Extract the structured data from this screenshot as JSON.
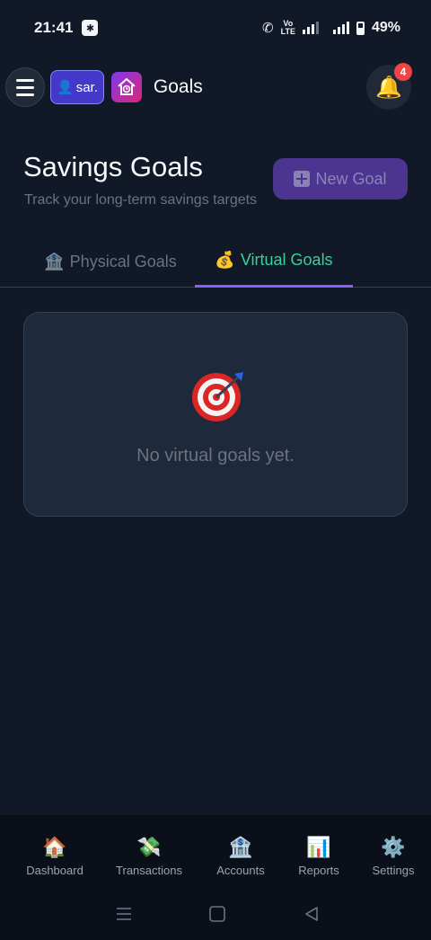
{
  "status_bar": {
    "time": "21:41",
    "network_top": "Vo",
    "network_bottom": "LTE",
    "battery": "49%"
  },
  "header": {
    "user_label": "sar.",
    "title": "Goals",
    "notification_count": "4"
  },
  "page": {
    "title": "Savings Goals",
    "subtitle": "Track your long-term savings targets",
    "new_goal_label": "New Goal"
  },
  "tabs": [
    {
      "icon": "🏦",
      "label": "Physical Goals",
      "active": false
    },
    {
      "icon": "💰",
      "label": "Virtual Goals",
      "active": true
    }
  ],
  "empty_state": {
    "message": "No virtual goals yet."
  },
  "bottom_nav": [
    {
      "icon": "🏠",
      "label": "Dashboard"
    },
    {
      "icon": "💸",
      "label": "Transactions"
    },
    {
      "icon": "🏦",
      "label": "Accounts"
    },
    {
      "icon": "📊",
      "label": "Reports"
    },
    {
      "icon": "⚙️",
      "label": "Settings"
    }
  ],
  "colors": {
    "background": "#111827",
    "accent_green": "#34d399",
    "accent_purple": "#8b5cf6",
    "badge_red": "#ef4444"
  }
}
